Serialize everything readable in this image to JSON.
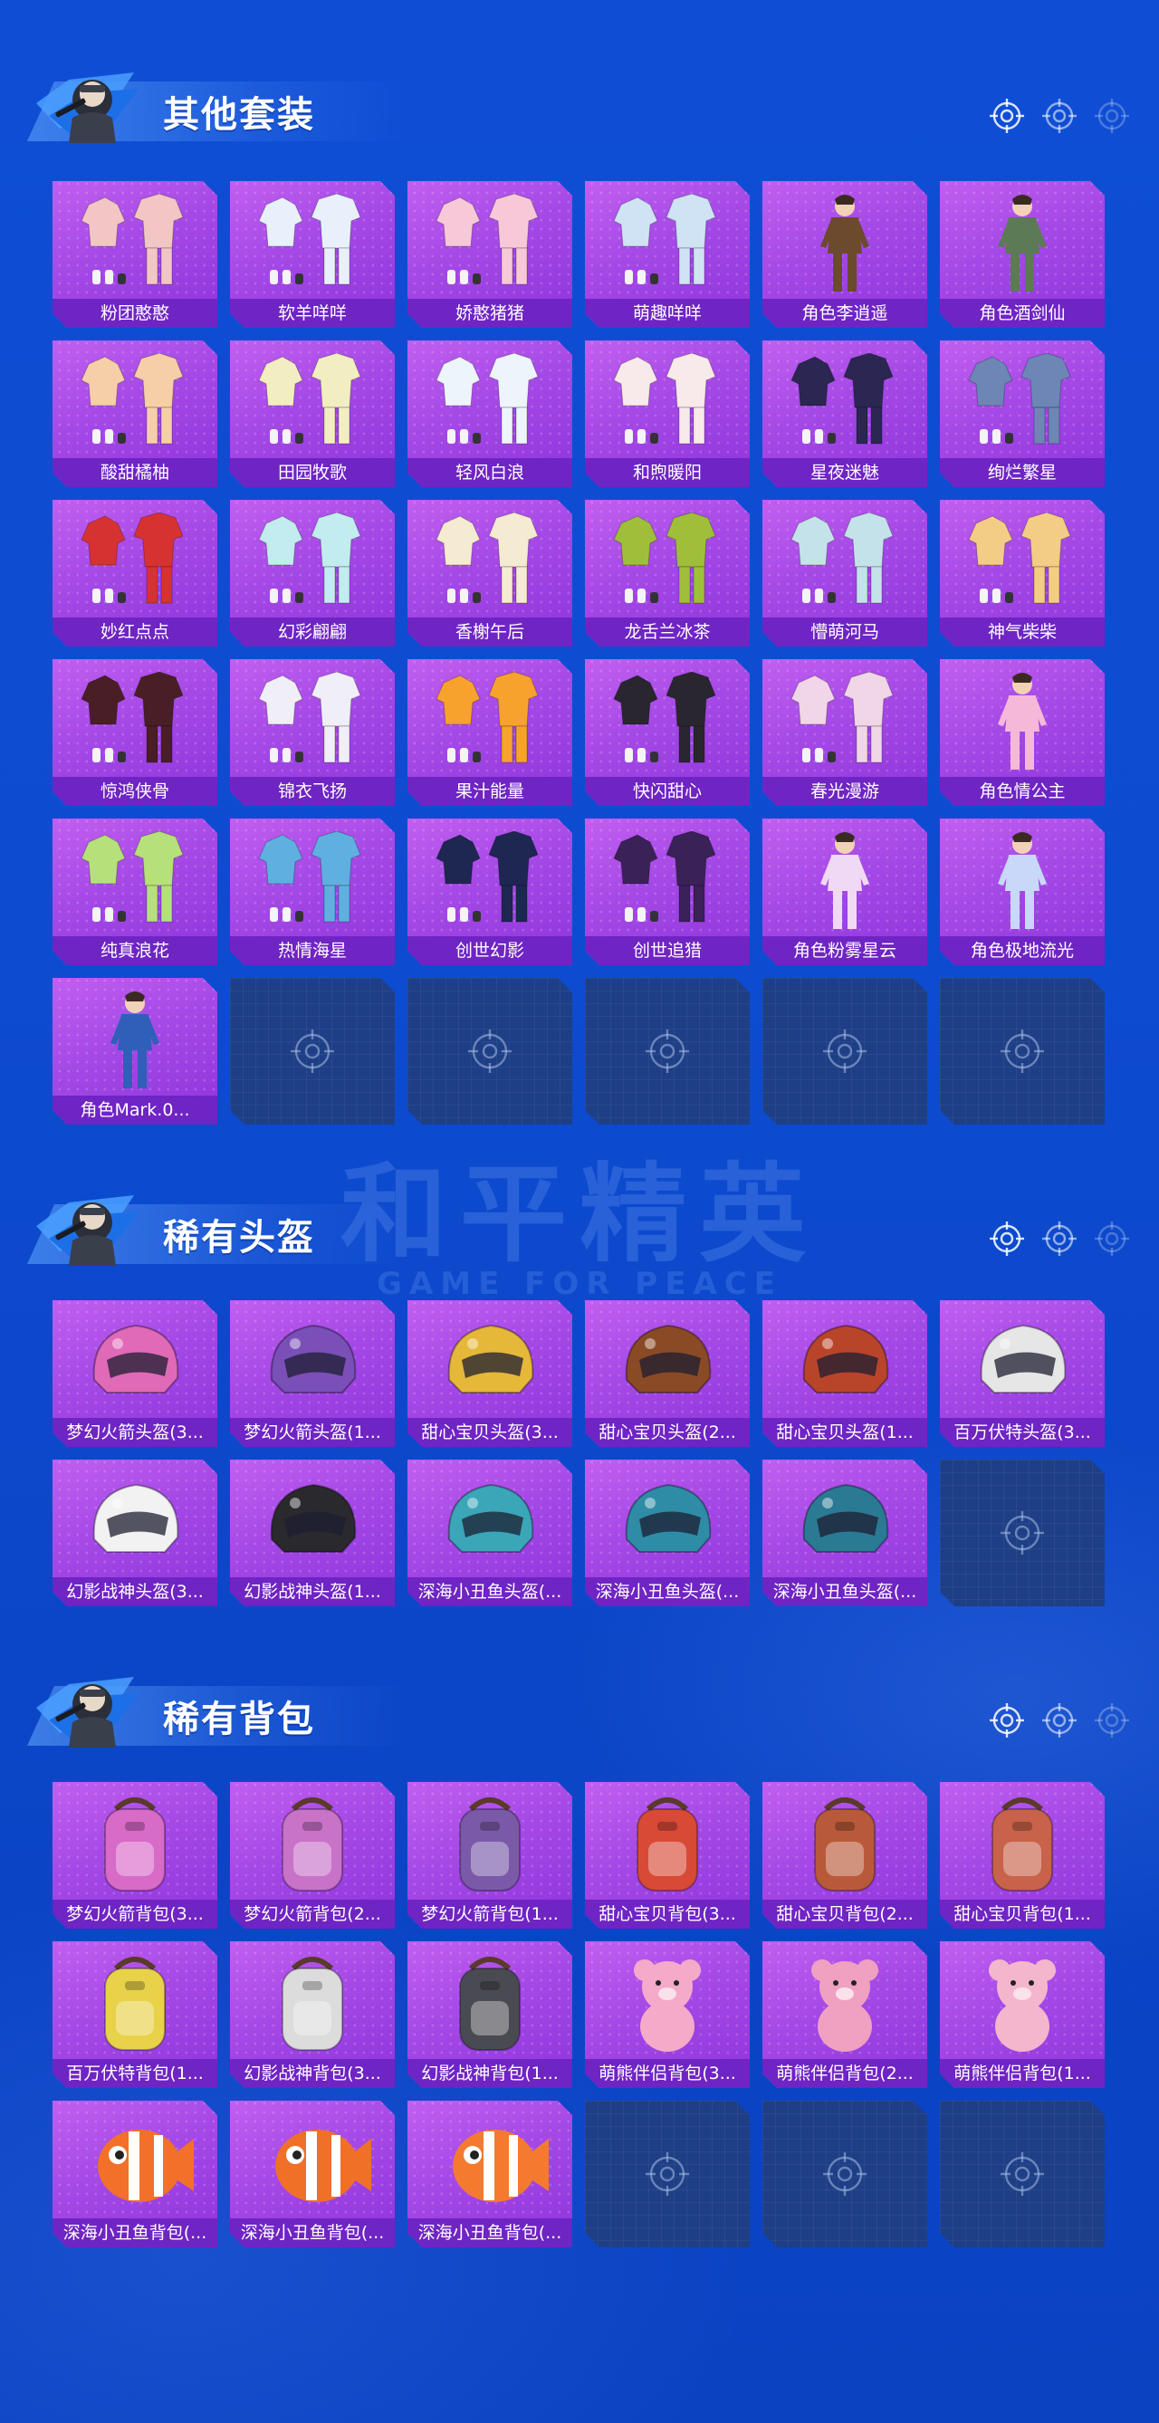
{
  "watermark": {
    "main": "和平精英",
    "sub": "GAME FOR PEACE"
  },
  "sections": [
    {
      "title": "其他套装",
      "items": [
        {
          "label": "粉团憨憨",
          "kind": "outfit",
          "color": "#f2c6c4"
        },
        {
          "label": "软羊咩咩",
          "kind": "outfit",
          "color": "#e8f1fb"
        },
        {
          "label": "娇憨猪猪",
          "kind": "outfit",
          "color": "#f7c9d8"
        },
        {
          "label": "萌趣咩咩",
          "kind": "outfit",
          "color": "#cfe3f5"
        },
        {
          "label": "角色李逍遥",
          "kind": "character",
          "color": "#6b4a2e"
        },
        {
          "label": "角色酒剑仙",
          "kind": "character",
          "color": "#5b7a55"
        },
        {
          "label": "酸甜橘柚",
          "kind": "outfit",
          "color": "#f6cfa8"
        },
        {
          "label": "田园牧歌",
          "kind": "outfit",
          "color": "#f2eec2"
        },
        {
          "label": "轻风白浪",
          "kind": "outfit",
          "color": "#eef4fb"
        },
        {
          "label": "和煦暖阳",
          "kind": "outfit",
          "color": "#f8eaea"
        },
        {
          "label": "星夜迷魅",
          "kind": "outfit",
          "color": "#2b2652"
        },
        {
          "label": "绚烂繁星",
          "kind": "outfit",
          "color": "#6d86b6"
        },
        {
          "label": "妙红点点",
          "kind": "outfit",
          "color": "#d73232"
        },
        {
          "label": "幻彩翩翩",
          "kind": "outfit",
          "color": "#c2ecef"
        },
        {
          "label": "香榭午后",
          "kind": "outfit",
          "color": "#f5ead2"
        },
        {
          "label": "龙舌兰冰茶",
          "kind": "outfit",
          "color": "#9fbf3a"
        },
        {
          "label": "懵萌河马",
          "kind": "outfit",
          "color": "#c4e2ea"
        },
        {
          "label": "神气柴柴",
          "kind": "outfit",
          "color": "#f3cd86"
        },
        {
          "label": "惊鸿侠骨",
          "kind": "outfit",
          "color": "#4a1e26"
        },
        {
          "label": "锦衣飞扬",
          "kind": "outfit",
          "color": "#f0eef7"
        },
        {
          "label": "果汁能量",
          "kind": "outfit",
          "color": "#f8a22e"
        },
        {
          "label": "快闪甜心",
          "kind": "outfit",
          "color": "#2a2630"
        },
        {
          "label": "春光漫游",
          "kind": "outfit",
          "color": "#f0d6e6"
        },
        {
          "label": "角色情公主",
          "kind": "character",
          "color": "#f6b8d8"
        },
        {
          "label": "纯真浪花",
          "kind": "outfit",
          "color": "#b6e07a"
        },
        {
          "label": "热情海星",
          "kind": "outfit",
          "color": "#5fb0e0"
        },
        {
          "label": "创世幻影",
          "kind": "outfit",
          "color": "#1e2652"
        },
        {
          "label": "创世追猎",
          "kind": "outfit",
          "color": "#3a2158"
        },
        {
          "label": "角色粉雾星云",
          "kind": "character",
          "color": "#f0d9f4"
        },
        {
          "label": "角色极地流光",
          "kind": "character",
          "color": "#c9d8f8"
        },
        {
          "label": "角色Mark.0...",
          "kind": "character",
          "color": "#2f5fb8"
        },
        {
          "empty": true
        },
        {
          "empty": true
        },
        {
          "empty": true
        },
        {
          "empty": true
        },
        {
          "empty": true
        }
      ]
    },
    {
      "title": "稀有头盔",
      "items": [
        {
          "label": "梦幻火箭头盔(3...",
          "kind": "helmet",
          "color": "#e06ab8"
        },
        {
          "label": "梦幻火箭头盔(1...",
          "kind": "helmet",
          "color": "#7a4fb8"
        },
        {
          "label": "甜心宝贝头盔(3...",
          "kind": "helmet",
          "color": "#e6b83a"
        },
        {
          "label": "甜心宝贝头盔(2...",
          "kind": "helmet",
          "color": "#8a4a26"
        },
        {
          "label": "甜心宝贝头盔(1...",
          "kind": "helmet",
          "color": "#b8452a"
        },
        {
          "label": "百万伏特头盔(3...",
          "kind": "helmet",
          "color": "#e6e6e6"
        },
        {
          "label": "幻影战神头盔(3...",
          "kind": "helmet",
          "color": "#f2f2f2"
        },
        {
          "label": "幻影战神头盔(1...",
          "kind": "helmet",
          "color": "#2a2a2e"
        },
        {
          "label": "深海小丑鱼头盔(...",
          "kind": "helmet",
          "color": "#3aa6b8"
        },
        {
          "label": "深海小丑鱼头盔(...",
          "kind": "helmet",
          "color": "#2e8ca6"
        },
        {
          "label": "深海小丑鱼头盔(...",
          "kind": "helmet",
          "color": "#2b7a94"
        },
        {
          "empty": true
        }
      ]
    },
    {
      "title": "稀有背包",
      "items": [
        {
          "label": "梦幻火箭背包(3...",
          "kind": "backpack",
          "color": "#d86ac8"
        },
        {
          "label": "梦幻火箭背包(2...",
          "kind": "backpack",
          "color": "#c872c8"
        },
        {
          "label": "梦幻火箭背包(1...",
          "kind": "backpack",
          "color": "#7a5aa8"
        },
        {
          "label": "甜心宝贝背包(3...",
          "kind": "backpack",
          "color": "#d84a36"
        },
        {
          "label": "甜心宝贝背包(2...",
          "kind": "backpack",
          "color": "#b85a3a"
        },
        {
          "label": "甜心宝贝背包(1...",
          "kind": "backpack",
          "color": "#c8624a"
        },
        {
          "label": "百万伏特背包(1...",
          "kind": "backpack",
          "color": "#e8d24a"
        },
        {
          "label": "幻影战神背包(3...",
          "kind": "backpack",
          "color": "#dcdcdc"
        },
        {
          "label": "幻影战神背包(1...",
          "kind": "backpack",
          "color": "#4a4a52"
        },
        {
          "label": "萌熊伴侣背包(3...",
          "kind": "bear",
          "color": "#f4aac8"
        },
        {
          "label": "萌熊伴侣背包(2...",
          "kind": "bear",
          "color": "#f0a0c0"
        },
        {
          "label": "萌熊伴侣背包(1...",
          "kind": "bear",
          "color": "#f4b6cc"
        },
        {
          "label": "深海小丑鱼背包(...",
          "kind": "fish",
          "color": "#f2702a"
        },
        {
          "label": "深海小丑鱼背包(...",
          "kind": "fish",
          "color": "#f07028"
        },
        {
          "label": "深海小丑鱼背包(...",
          "kind": "fish",
          "color": "#f47a30"
        },
        {
          "empty": true
        },
        {
          "empty": true
        },
        {
          "empty": true
        }
      ]
    }
  ]
}
